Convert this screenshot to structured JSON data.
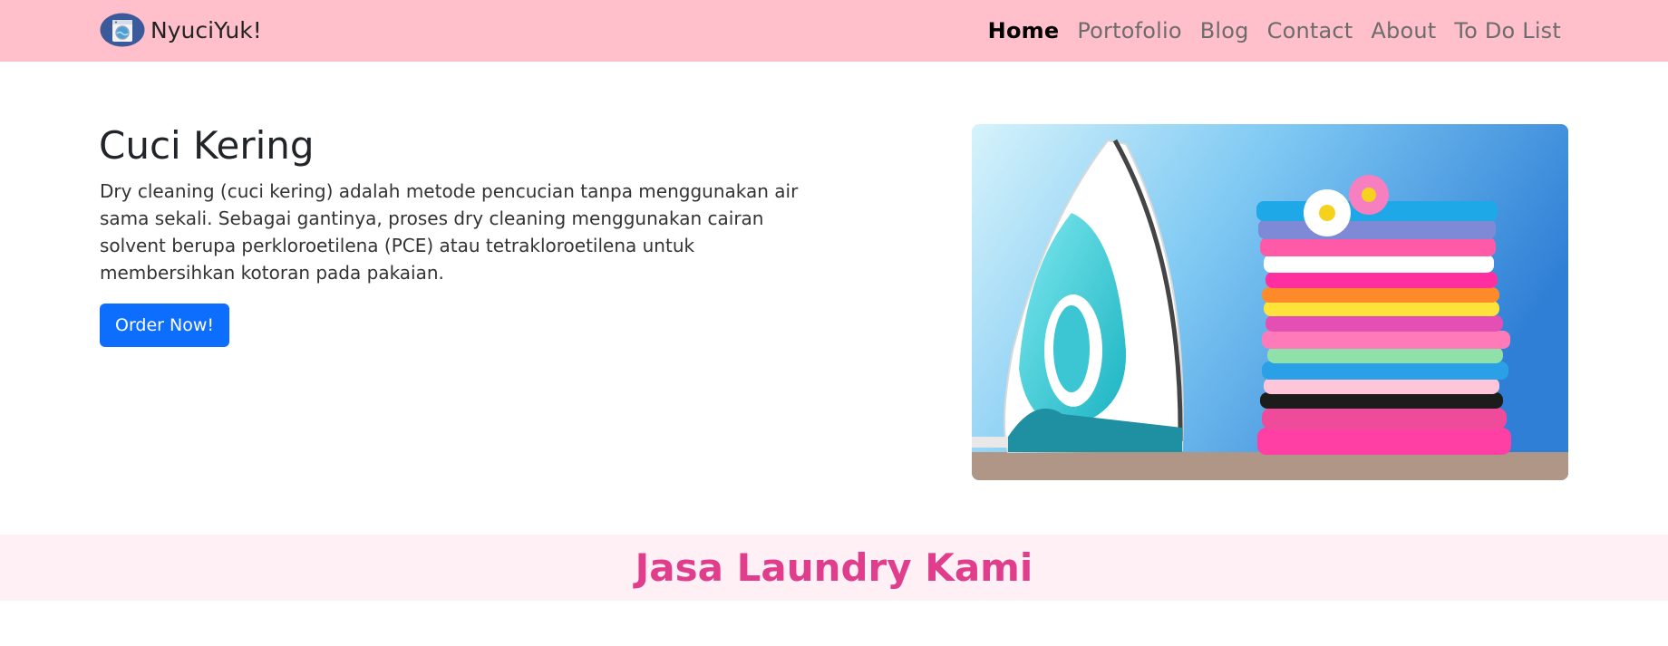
{
  "navbar": {
    "brand": {
      "name": "NyuciYuk!",
      "logo_icon": "washing-machine-icon"
    },
    "links": [
      {
        "label": "Home",
        "active": true
      },
      {
        "label": "Portofolio",
        "active": false
      },
      {
        "label": "Blog",
        "active": false
      },
      {
        "label": "Contact",
        "active": false
      },
      {
        "label": "About",
        "active": false
      },
      {
        "label": "To Do List",
        "active": false
      }
    ]
  },
  "hero": {
    "title": "Cuci Kering",
    "description": "Dry cleaning (cuci kering) adalah metode pencucian tanpa menggunakan air sama sekali. Sebagai gantinya, proses dry cleaning menggunakan cairan solvent berupa perkloroetilena (PCE) atau tetrakloroetilena untuk membersihkan kotoran pada pakaian.",
    "cta_label": "Order Now!",
    "image_subject": "iron-and-folded-clothes"
  },
  "services": {
    "title": "Jasa Laundry Kami"
  },
  "colors": {
    "navbar_bg": "#ffc0cb",
    "primary_button": "#0d6efd",
    "section_title": "#e03e8c",
    "section_bg": "#fff0f6"
  }
}
